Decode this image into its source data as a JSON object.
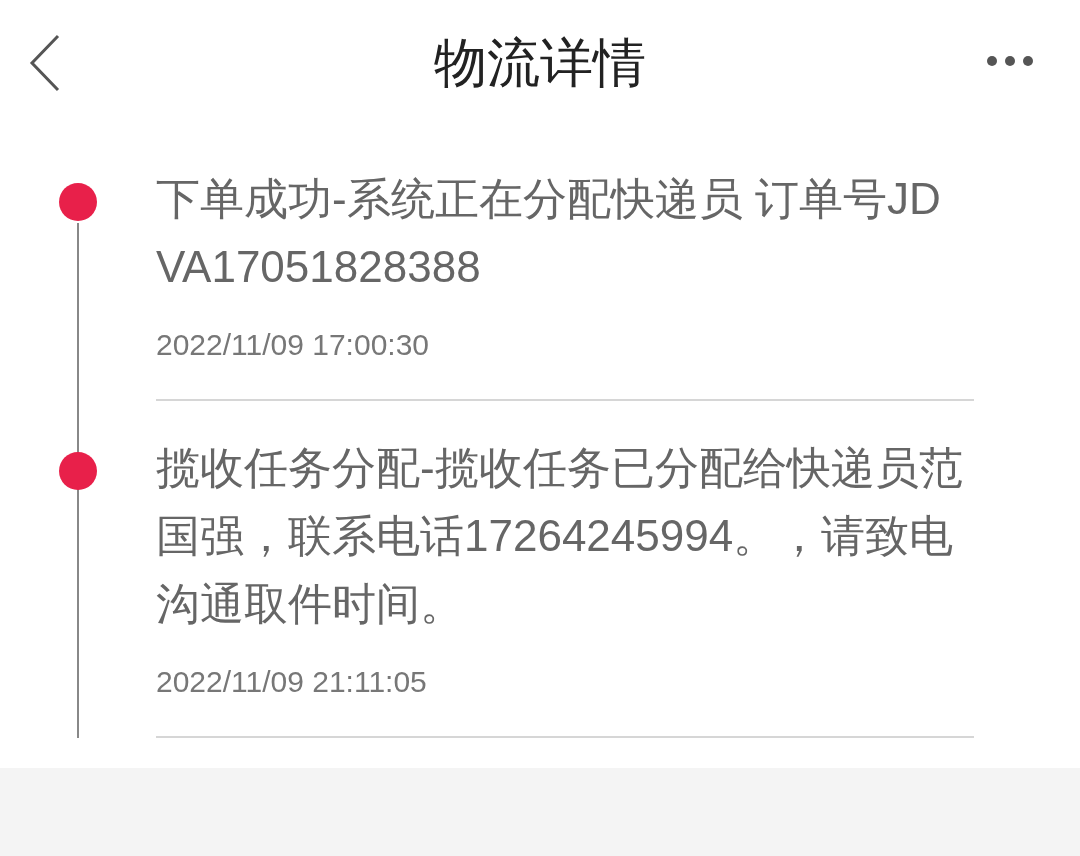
{
  "header": {
    "title": "物流详情"
  },
  "timeline": [
    {
      "text": "下单成功-系统正在分配快递员 订单号JD VA17051828388",
      "time": "2022/11/09 17:00:30"
    },
    {
      "text": "揽收任务分配-揽收任务已分配给快递员范国强，联系电话17264245994。，请致电沟通取件时间。",
      "time": "2022/11/09 21:11:05"
    }
  ]
}
